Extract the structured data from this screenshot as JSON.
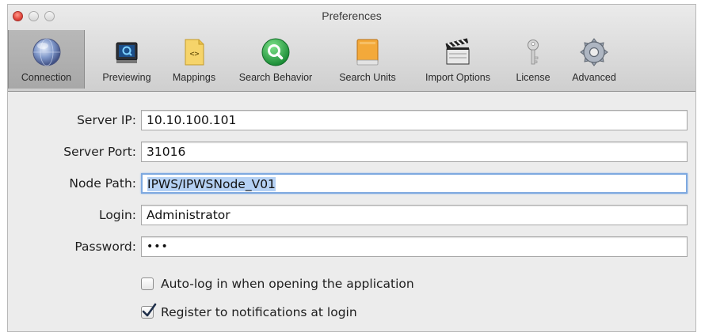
{
  "window": {
    "title": "Preferences"
  },
  "toolbar": {
    "items": [
      {
        "label": "Connection",
        "icon": "globe-icon",
        "selected": true
      },
      {
        "label": "Previewing",
        "icon": "monitor-preview-icon",
        "selected": false
      },
      {
        "label": "Mappings",
        "icon": "document-code-icon",
        "selected": false
      },
      {
        "label": "Search Behavior",
        "icon": "magnifier-icon",
        "selected": false
      },
      {
        "label": "Search Units",
        "icon": "orange-drive-icon",
        "selected": false
      },
      {
        "label": "Import Options",
        "icon": "clapperboard-icon",
        "selected": false
      },
      {
        "label": "License",
        "icon": "key-icon",
        "selected": false
      },
      {
        "label": "Advanced",
        "icon": "gear-icon",
        "selected": false
      }
    ]
  },
  "form": {
    "server_ip": {
      "label": "Server IP:",
      "value": "10.10.100.101"
    },
    "server_port": {
      "label": "Server Port:",
      "value": "31016"
    },
    "node_path": {
      "label": "Node Path:",
      "value": "IPWS/IPWSNode_V01"
    },
    "login": {
      "label": "Login:",
      "value": "Administrator"
    },
    "password": {
      "label": "Password:",
      "value": "•••"
    }
  },
  "options": {
    "auto_login": {
      "label": "Auto-log in when opening the application",
      "checked": false
    },
    "register_notifications": {
      "label": "Register to notifications at login",
      "checked": true
    }
  },
  "colors": {
    "selection_highlight": "#b5d1f4",
    "focus_ring": "#7ea9e0",
    "search_icon_green": "#2aa845",
    "close_button": "#e0443b"
  }
}
